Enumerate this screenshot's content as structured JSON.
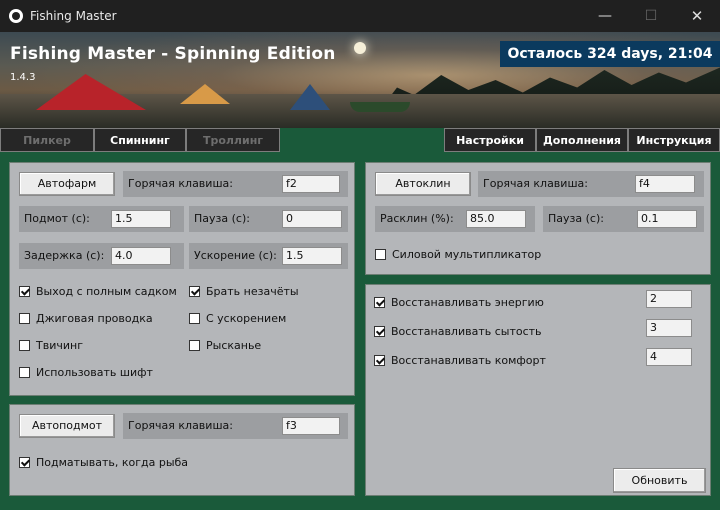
{
  "window": {
    "title": "Fishing Master",
    "minimize_glyph": "—",
    "maximize_glyph": "☐",
    "close_glyph": "✕"
  },
  "banner": {
    "title": "Fishing Master - Spinning Edition",
    "version": "1.4.3",
    "license_text": "Осталось 324 days, 21:04"
  },
  "tabs": [
    {
      "label": "Пилкер",
      "enabled": false
    },
    {
      "label": "Спиннинг",
      "enabled": true
    },
    {
      "label": "Троллинг",
      "enabled": false
    },
    {
      "label": "Настройки",
      "enabled": true
    },
    {
      "label": "Дополнения",
      "enabled": true
    },
    {
      "label": "Инструкция",
      "enabled": true
    }
  ],
  "autofarm": {
    "button": "Автофарм",
    "hotkey_label": "Горячая клавиша:",
    "hotkey_value": "f2",
    "podmot_label": "Подмот (с):",
    "podmot_value": "1.5",
    "pause_label": "Пауза (с):",
    "pause_value": "0",
    "delay_label": "Задержка (с):",
    "delay_value": "4.0",
    "accel_label": "Ускорение (с):",
    "accel_value": "1.5",
    "options": [
      {
        "label": "Выход с полным садком",
        "checked": true
      },
      {
        "label": "Брать незачёты",
        "checked": true
      },
      {
        "label": "Джиговая проводка",
        "checked": false
      },
      {
        "label": "С ускорением",
        "checked": false
      },
      {
        "label": "Твичинг",
        "checked": false
      },
      {
        "label": "Рысканье",
        "checked": false
      },
      {
        "label": "Использовать шифт",
        "checked": false
      }
    ]
  },
  "autoclean": {
    "button": "Автоклин",
    "hotkey_label": "Горячая клавиша:",
    "hotkey_value": "f4",
    "rasklin_label": "Расклин (%):",
    "rasklin_value": "85.0",
    "pause_label": "Пауза (с):",
    "pause_value": "0.1",
    "power_multiplier_label": "Силовой мультипликатор",
    "power_multiplier_checked": false
  },
  "restore": {
    "items": [
      {
        "label": "Восстанавливать энергию",
        "checked": true,
        "value": "2"
      },
      {
        "label": "Восстанавливать сытость",
        "checked": true,
        "value": "3"
      },
      {
        "label": "Восстанавливать комфорт",
        "checked": true,
        "value": "4"
      }
    ],
    "update_button": "Обновить"
  },
  "autopodmot": {
    "button": "Автоподмот",
    "hotkey_label": "Горячая клавиша:",
    "hotkey_value": "f3",
    "option_label": "Подматывать, когда рыба",
    "option_checked": true
  },
  "colors": {
    "frame_green": "#1a5a3a",
    "panel_grey": "#b4b6b9",
    "license_blue": "#0b3a5e",
    "tab_dark": "#262626"
  }
}
